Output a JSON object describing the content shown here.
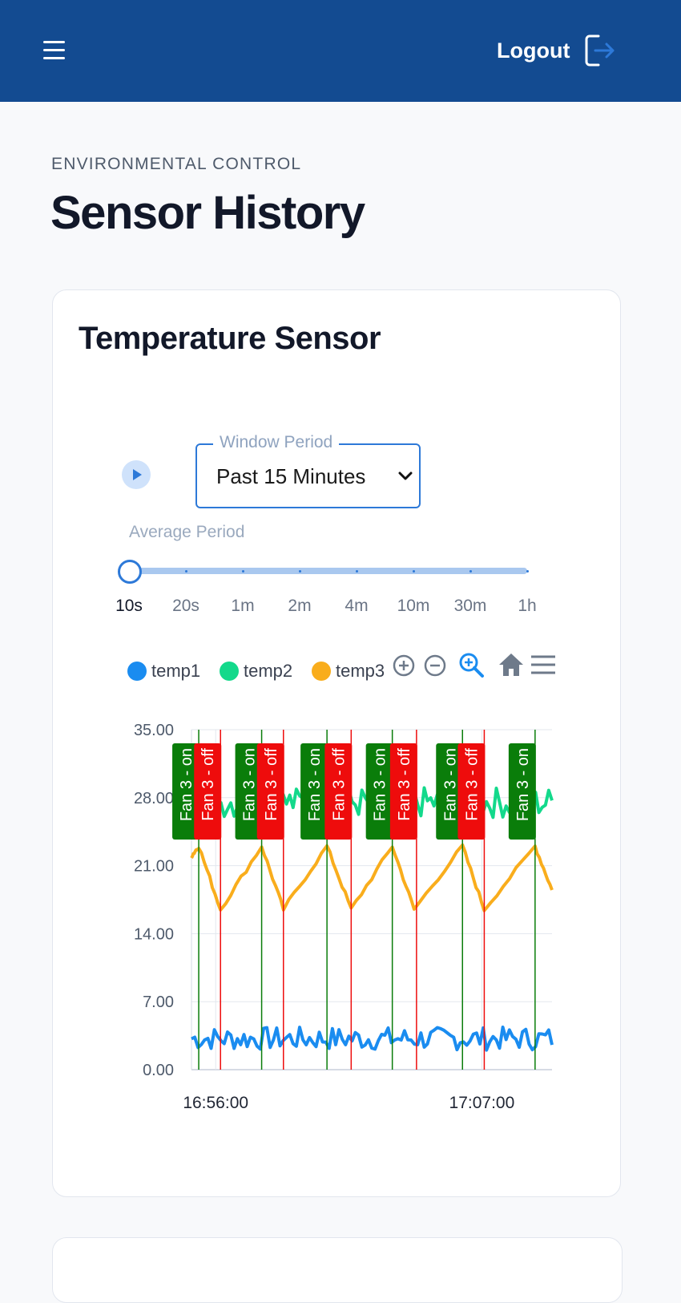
{
  "header": {
    "logout_label": "Logout"
  },
  "page": {
    "eyebrow": "ENVIRONMENTAL CONTROL",
    "title": "Sensor History"
  },
  "card": {
    "title": "Temperature Sensor",
    "window_period": {
      "legend": "Window Period",
      "value": "Past 15 Minutes"
    },
    "average_period": {
      "label": "Average Period",
      "options": [
        "10s",
        "20s",
        "1m",
        "2m",
        "4m",
        "10m",
        "30m",
        "1h"
      ],
      "selected_index": 0
    }
  },
  "toolbar_icons": [
    "zoom-in-icon",
    "zoom-out-icon",
    "zoom-select-icon",
    "home-icon",
    "menu-icon"
  ],
  "colors": {
    "header": "#134b91",
    "accent": "#2d79d8",
    "temp1": "#1a8cf0",
    "temp2": "#13d98b",
    "temp3": "#f9ad1c",
    "fan_on": "#0a7d0a",
    "fan_off": "#ee0c0c"
  },
  "chart_data": {
    "type": "line",
    "ylim": [
      0,
      35
    ],
    "y_ticks": [
      "0.00",
      "7.00",
      "14.00",
      "21.00",
      "28.00",
      "35.00"
    ],
    "x_ticks": [
      "16:56:00",
      "17:07:00"
    ],
    "x_tick_positions_min": [
      1.0,
      12.0
    ],
    "xlim_min": [
      0,
      14.9
    ],
    "series": [
      {
        "name": "temp1",
        "base": 3.2,
        "amp": 1.2
      },
      {
        "name": "temp2",
        "base": 27.5,
        "amp": 1.6
      },
      {
        "name": "temp3",
        "peaks": [
          [
            0,
            22
          ],
          [
            0.3,
            23
          ],
          [
            1.2,
            16.5
          ],
          [
            2.9,
            23
          ],
          [
            3.8,
            16.5
          ],
          [
            5.6,
            23
          ],
          [
            6.6,
            16.5
          ],
          [
            8.3,
            23
          ],
          [
            9.2,
            16.5
          ],
          [
            11.2,
            23
          ],
          [
            12.1,
            16.5
          ],
          [
            14.2,
            23
          ],
          [
            14.9,
            18.5
          ]
        ]
      }
    ],
    "annotations": [
      {
        "label": "Fan 3 - on",
        "x_min": 0.3,
        "type": "on"
      },
      {
        "label": "Fan 3 - off",
        "x_min": 1.2,
        "type": "off"
      },
      {
        "label": "Fan 3 - on",
        "x_min": 2.9,
        "type": "on"
      },
      {
        "label": "Fan 3 - off",
        "x_min": 3.8,
        "type": "off"
      },
      {
        "label": "Fan 3 - on",
        "x_min": 5.6,
        "type": "on"
      },
      {
        "label": "Fan 3 - off",
        "x_min": 6.6,
        "type": "off"
      },
      {
        "label": "Fan 3 - on",
        "x_min": 8.3,
        "type": "on"
      },
      {
        "label": "Fan 3 - off",
        "x_min": 9.3,
        "type": "off"
      },
      {
        "label": "Fan 3 - on",
        "x_min": 11.2,
        "type": "on"
      },
      {
        "label": "Fan 3 - off",
        "x_min": 12.1,
        "type": "off"
      },
      {
        "label": "Fan 3 - on",
        "x_min": 14.2,
        "type": "on"
      }
    ]
  }
}
